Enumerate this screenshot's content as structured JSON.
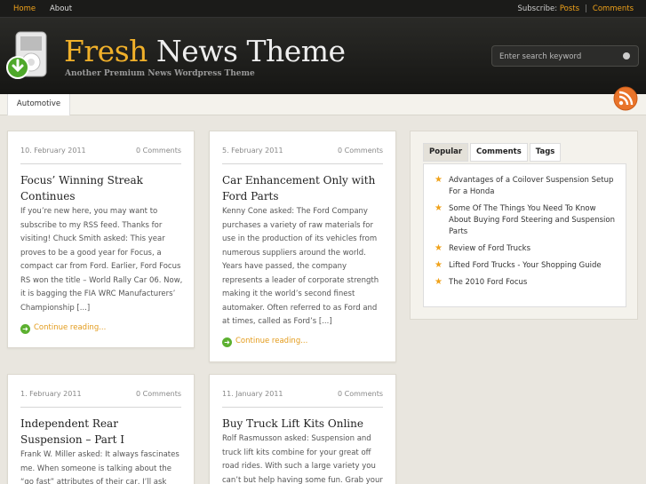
{
  "topnav": {
    "home": "Home",
    "about": "About"
  },
  "subscribe": {
    "label": "Subscribe:",
    "posts": "Posts",
    "sep": "|",
    "comments": "Comments"
  },
  "header": {
    "title_part1": "Fresh",
    "title_part2": " News Theme",
    "tagline": "Another Premium News Wordpress Theme"
  },
  "search": {
    "placeholder": "Enter search keyword"
  },
  "category_tab": "Automotive",
  "posts": [
    {
      "date": "10. February 2011",
      "comments": "0 Comments",
      "title": "Focus’ Winning Streak Continues",
      "excerpt": "If you’re new here, you may want to subscribe to my RSS feed. Thanks for visiting! Chuck Smith asked: This year proves to be a good year for Focus, a compact car from Ford. Earlier, Ford Focus RS won the title – World Rally Car 06. Now, it is bagging the FIA WRC Manufacturers’ Championship [...]",
      "more": "Continue reading..."
    },
    {
      "date": "5. February 2011",
      "comments": "0 Comments",
      "title": "Car Enhancement Only with Ford Parts",
      "excerpt": "Kenny Cone asked: The Ford Company purchases a variety of raw materials for use in the production of its vehicles from numerous suppliers around the world. Years have passed, the company represents a leader of corporate strength making it the world’s second finest automaker. Often referred to as Ford and at times, called as Ford’s [...]",
      "more": "Continue reading..."
    },
    {
      "date": "1. February 2011",
      "comments": "0 Comments",
      "title": "Independent Rear Suspension – Part I",
      "excerpt": "Frank W. Miller asked: It always fascinates me. When someone is talking about the “go fast” attributes of their car, I’ll ask them"
    },
    {
      "date": "11. January 2011",
      "comments": "0 Comments",
      "title": "Buy Truck Lift Kits Online",
      "excerpt": "Rolf Rasmusson asked: Suspension and truck lift kits combine for your great off road rides. With such a large variety you can’t but help having some fun. Grab your favorite"
    }
  ],
  "sidebar": {
    "tabs": [
      "Popular",
      "Comments",
      "Tags"
    ],
    "items": [
      "Advantages of a Coilover Suspension Setup For a Honda",
      "Some Of The Things You Need To Know About Buying Ford Steering and Suspension Parts",
      "Review of Ford Trucks",
      "Lifted Ford Trucks - Your Shopping Guide",
      "The 2010 Ford Focus"
    ]
  },
  "colors": {
    "accent": "#f0a21a",
    "link_green": "#5cb030",
    "dark_header": "#1b1b19"
  },
  "icons": {
    "logo": "ipod-download-icon",
    "rss": "rss-feed-icon",
    "continue": "arrow-right-circle-icon",
    "list": "star-icon"
  }
}
